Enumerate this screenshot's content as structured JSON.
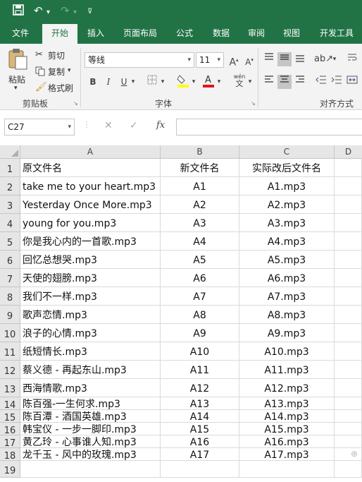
{
  "qat": {
    "save_icon": "save-icon",
    "undo_icon": "undo-icon",
    "redo_icon": "redo-icon",
    "customize_icon": "chevron-down-icon"
  },
  "tabs": [
    "文件",
    "开始",
    "插入",
    "页面布局",
    "公式",
    "数据",
    "审阅",
    "视图",
    "开发工具"
  ],
  "active_tab": "开始",
  "ribbon": {
    "paste_label": "粘贴",
    "cut_label": "剪切",
    "copy_label": "复制",
    "format_painter_label": "格式刷",
    "clipboard_group": "剪贴板",
    "font_name": "等线",
    "font_size": "11",
    "bold": "B",
    "italic": "I",
    "underline": "U",
    "grow_font": "A",
    "shrink_font": "A",
    "phonetic": "wén",
    "font_group": "字体",
    "alignment_group": "对齐方式"
  },
  "formula_bar": {
    "name_box": "C27",
    "cancel": "✕",
    "enter": "✓",
    "fx": "fx",
    "value": ""
  },
  "columns": [
    "A",
    "B",
    "C",
    "D"
  ],
  "rows": [
    {
      "n": "1",
      "a": "原文件名",
      "b": "新文件名",
      "c": "实际改后文件名"
    },
    {
      "n": "2",
      "a": "take me to your heart.mp3",
      "b": "A1",
      "c": "A1.mp3"
    },
    {
      "n": "3",
      "a": "Yesterday Once More.mp3",
      "b": "A2",
      "c": "A2.mp3"
    },
    {
      "n": "4",
      "a": "young for you.mp3",
      "b": "A3",
      "c": "A3.mp3"
    },
    {
      "n": "5",
      "a": "你是我心内的一首歌.mp3",
      "b": "A4",
      "c": "A4.mp3"
    },
    {
      "n": "6",
      "a": "回忆总想哭.mp3",
      "b": "A5",
      "c": "A5.mp3"
    },
    {
      "n": "7",
      "a": "天使的翅膀.mp3",
      "b": "A6",
      "c": "A6.mp3"
    },
    {
      "n": "8",
      "a": "我们不一样.mp3",
      "b": "A7",
      "c": "A7.mp3"
    },
    {
      "n": "9",
      "a": "歌声恋情.mp3",
      "b": "A8",
      "c": "A8.mp3"
    },
    {
      "n": "10",
      "a": "浪子的心情.mp3",
      "b": "A9",
      "c": "A9.mp3"
    },
    {
      "n": "11",
      "a": "纸短情长.mp3",
      "b": "A10",
      "c": "A10.mp3"
    },
    {
      "n": "12",
      "a": "蔡义德 - 再起东山.mp3",
      "b": "A11",
      "c": "A11.mp3"
    },
    {
      "n": "13",
      "a": "西海情歌.mp3",
      "b": "A12",
      "c": "A12.mp3"
    },
    {
      "n": "14",
      "a": "陈百强-一生何求.mp3",
      "b": "A13",
      "c": "A13.mp3"
    },
    {
      "n": "15",
      "a": "陈百潭 - 酒国英雄.mp3",
      "b": "A14",
      "c": "A14.mp3"
    },
    {
      "n": "16",
      "a": "韩宝仪 - 一步一脚印.mp3",
      "b": "A15",
      "c": "A15.mp3"
    },
    {
      "n": "17",
      "a": "黄乙玲 - 心事谁人知.mp3",
      "b": "A16",
      "c": "A16.mp3"
    },
    {
      "n": "18",
      "a": "龙千玉 - 风中的玫瑰.mp3",
      "b": "A17",
      "c": "A17.mp3"
    },
    {
      "n": "19",
      "a": "",
      "b": "",
      "c": ""
    }
  ],
  "colors": {
    "brand": "#217346",
    "ribbon_bg": "#f3f3f3",
    "font_color_bar": "#e81123",
    "highlight_bar": "#ffff00"
  }
}
